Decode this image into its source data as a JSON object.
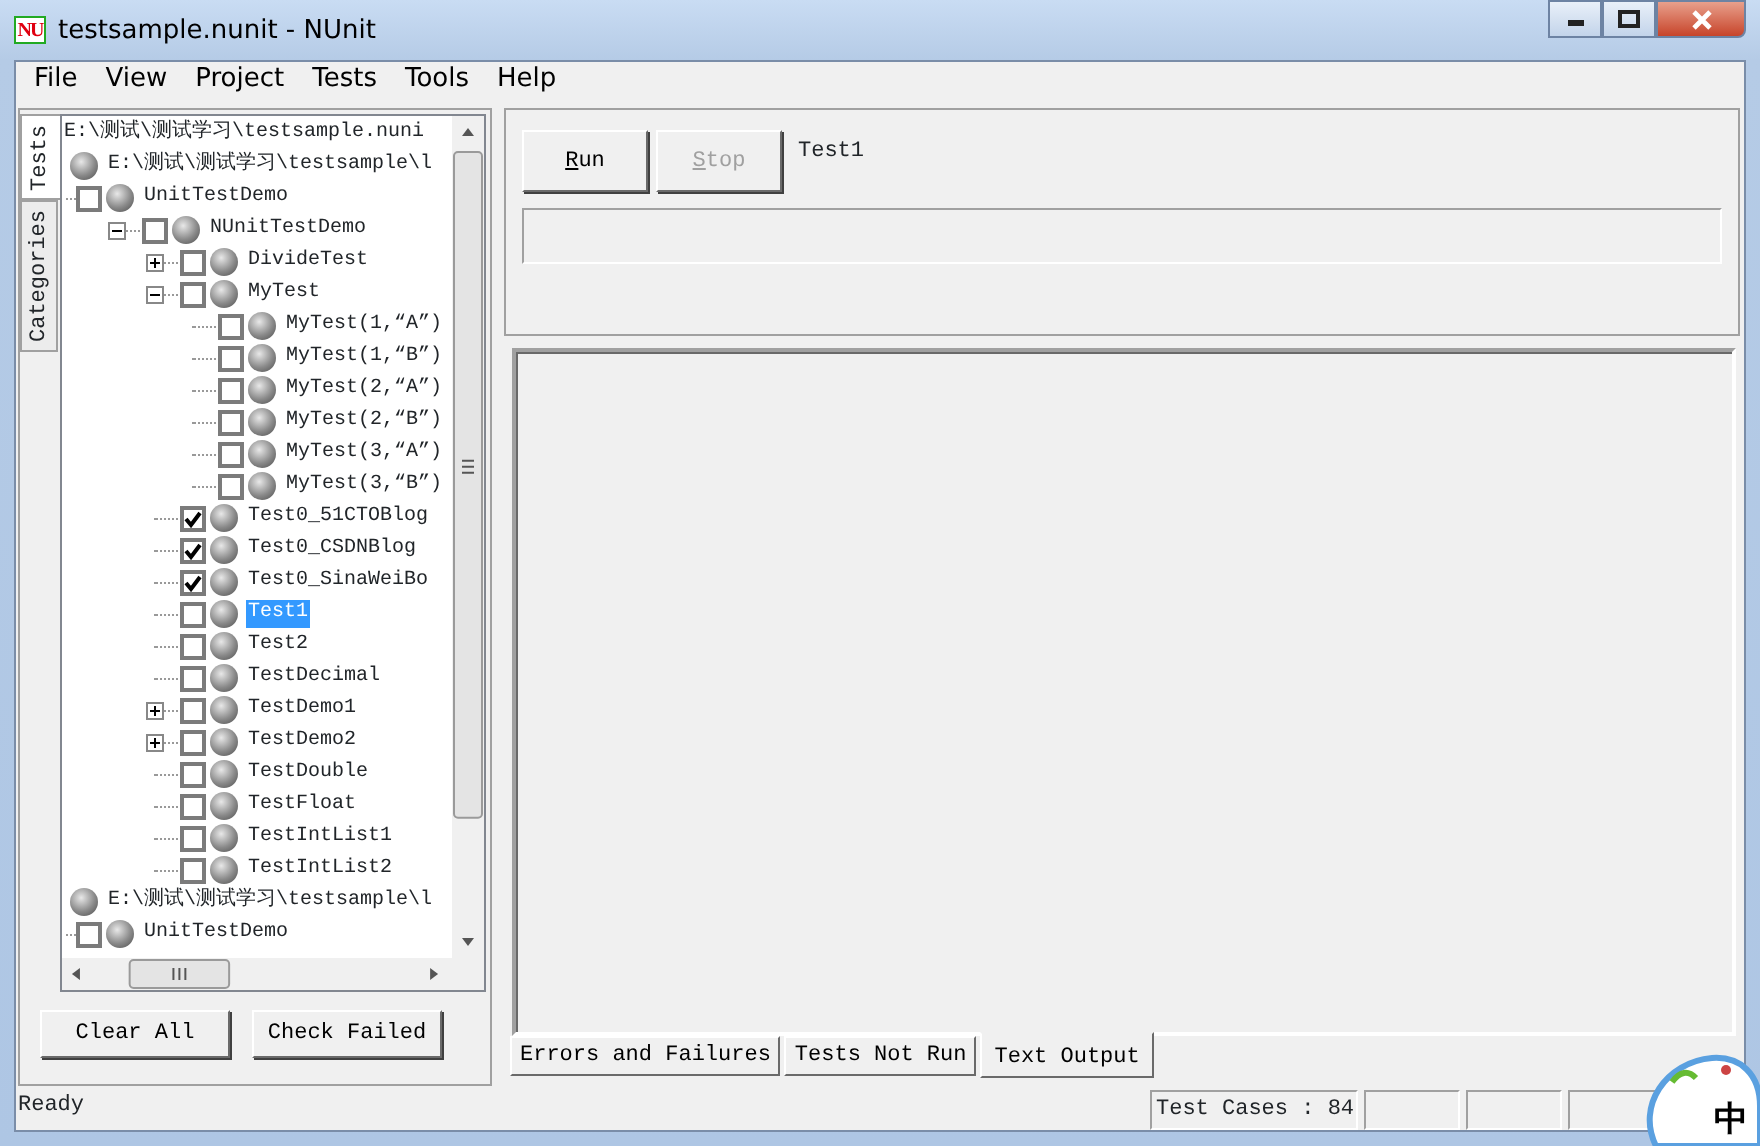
{
  "window": {
    "title": "testsample.nunit - NUnit",
    "logo": "NU"
  },
  "menu": [
    "File",
    "View",
    "Project",
    "Tests",
    "Tools",
    "Help"
  ],
  "side_tabs": [
    {
      "label": "Tests",
      "selected": true
    },
    {
      "label": "Categories",
      "selected": false
    }
  ],
  "tree": {
    "header": "E:\\测试\\测试学习\\testsample.nuni",
    "nodes": [
      {
        "label": "E:\\测试\\测试学习\\testsample\\l",
        "kind": "assembly",
        "selected": false,
        "children": [
          {
            "label": "UnitTestDemo",
            "kind": "test",
            "checked": false,
            "selected": false,
            "children": [
              {
                "label": "NUnitTestDemo",
                "kind": "test",
                "checked": false,
                "selected": false,
                "expanded": true,
                "children": [
                  {
                    "label": "DivideTest",
                    "kind": "test",
                    "checked": false,
                    "selected": false,
                    "expanded": false
                  },
                  {
                    "label": "MyTest",
                    "kind": "test",
                    "checked": false,
                    "selected": false,
                    "expanded": true,
                    "children": [
                      {
                        "label": "MyTest(1,“A”)",
                        "kind": "test",
                        "checked": false,
                        "selected": false
                      },
                      {
                        "label": "MyTest(1,“B”)",
                        "kind": "test",
                        "checked": false,
                        "selected": false
                      },
                      {
                        "label": "MyTest(2,“A”)",
                        "kind": "test",
                        "checked": false,
                        "selected": false
                      },
                      {
                        "label": "MyTest(2,“B”)",
                        "kind": "test",
                        "checked": false,
                        "selected": false
                      },
                      {
                        "label": "MyTest(3,“A”)",
                        "kind": "test",
                        "checked": false,
                        "selected": false
                      },
                      {
                        "label": "MyTest(3,“B”)",
                        "kind": "test",
                        "checked": false,
                        "selected": false
                      }
                    ]
                  },
                  {
                    "label": "Test0_51CTOBlog",
                    "kind": "test",
                    "checked": true,
                    "selected": false
                  },
                  {
                    "label": "Test0_CSDNBlog",
                    "kind": "test",
                    "checked": true,
                    "selected": false
                  },
                  {
                    "label": "Test0_SinaWeiBo",
                    "kind": "test",
                    "checked": true,
                    "selected": false
                  },
                  {
                    "label": "Test1",
                    "kind": "test",
                    "checked": false,
                    "selected": true
                  },
                  {
                    "label": "Test2",
                    "kind": "test",
                    "checked": false,
                    "selected": false
                  },
                  {
                    "label": "TestDecimal",
                    "kind": "test",
                    "checked": false,
                    "selected": false
                  },
                  {
                    "label": "TestDemo1",
                    "kind": "test",
                    "checked": false,
                    "selected": false,
                    "expanded": false
                  },
                  {
                    "label": "TestDemo2",
                    "kind": "test",
                    "checked": false,
                    "selected": false,
                    "expanded": false
                  },
                  {
                    "label": "TestDouble",
                    "kind": "test",
                    "checked": false,
                    "selected": false
                  },
                  {
                    "label": "TestFloat",
                    "kind": "test",
                    "checked": false,
                    "selected": false
                  },
                  {
                    "label": "TestIntList1",
                    "kind": "test",
                    "checked": false,
                    "selected": false
                  },
                  {
                    "label": "TestIntList2",
                    "kind": "test",
                    "checked": false,
                    "selected": false
                  }
                ]
              }
            ]
          }
        ]
      },
      {
        "label": "E:\\测试\\测试学习\\testsample\\l",
        "kind": "assembly",
        "selected": false,
        "children": [
          {
            "label": "UnitTestDemo",
            "kind": "test",
            "checked": false,
            "selected": false
          }
        ]
      }
    ]
  },
  "tree_buttons": [
    "Clear All",
    "Check Failed"
  ],
  "run_buttons": [
    {
      "label": "Run",
      "disabled": false
    },
    {
      "label": "Stop",
      "disabled": true
    }
  ],
  "current_test": "Test1",
  "progress": {
    "level": 0
  },
  "result_tabs": [
    {
      "label": "Errors and Failures",
      "selected": false
    },
    {
      "label": "Tests Not Run",
      "selected": false
    },
    {
      "label": "Text Output",
      "selected": true
    }
  ],
  "status_bar": {
    "text": "Ready",
    "panels": [
      "Test Cases : 84"
    ]
  },
  "ime_indicator": {
    "label": "中"
  }
}
